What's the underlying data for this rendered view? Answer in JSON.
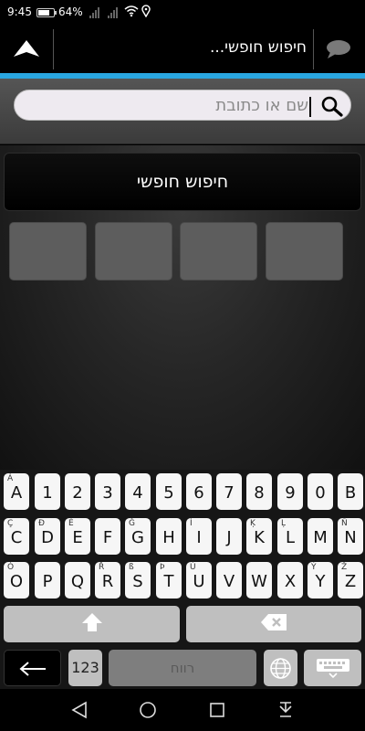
{
  "status_bar": {
    "time": "9:45",
    "battery_percent": "64%",
    "battery_level": 0.64
  },
  "header": {
    "title": "חיפוש חופשי...",
    "icons": [
      "navigation-arrow-icon",
      "chat-bubble-icon"
    ]
  },
  "search": {
    "placeholder": "שם או כתובת",
    "icons": [
      "magnifier-icon"
    ]
  },
  "content": {
    "free_search_label": "חיפוש חופשי",
    "tile_count": 4
  },
  "keyboard": {
    "row1": [
      {
        "main": "A",
        "sub": "Á"
      },
      {
        "main": "1",
        "sub": ""
      },
      {
        "main": "2",
        "sub": ""
      },
      {
        "main": "3",
        "sub": ""
      },
      {
        "main": "4",
        "sub": ""
      },
      {
        "main": "5",
        "sub": ""
      },
      {
        "main": "6",
        "sub": ""
      },
      {
        "main": "7",
        "sub": ""
      },
      {
        "main": "8",
        "sub": ""
      },
      {
        "main": "9",
        "sub": ""
      },
      {
        "main": "0",
        "sub": ""
      },
      {
        "main": "B",
        "sub": ""
      }
    ],
    "row2": [
      {
        "main": "C",
        "sub": "Ç"
      },
      {
        "main": "D",
        "sub": "Đ"
      },
      {
        "main": "E",
        "sub": "É"
      },
      {
        "main": "F",
        "sub": ""
      },
      {
        "main": "G",
        "sub": "Ğ"
      },
      {
        "main": "H",
        "sub": ""
      },
      {
        "main": "I",
        "sub": "Í"
      },
      {
        "main": "J",
        "sub": ""
      },
      {
        "main": "K",
        "sub": "Ķ"
      },
      {
        "main": "L",
        "sub": "Ļ"
      },
      {
        "main": "M",
        "sub": ""
      },
      {
        "main": "N",
        "sub": "Ñ"
      }
    ],
    "row3": [
      {
        "main": "O",
        "sub": "Ó"
      },
      {
        "main": "P",
        "sub": ""
      },
      {
        "main": "Q",
        "sub": ""
      },
      {
        "main": "R",
        "sub": "Ř"
      },
      {
        "main": "S",
        "sub": "ß"
      },
      {
        "main": "T",
        "sub": "Þ"
      },
      {
        "main": "U",
        "sub": "Ú"
      },
      {
        "main": "V",
        "sub": ""
      },
      {
        "main": "W",
        "sub": ""
      },
      {
        "main": "X",
        "sub": ""
      },
      {
        "main": "Y",
        "sub": "Ý"
      },
      {
        "main": "Z",
        "sub": "Ž"
      }
    ],
    "mode_label": "123",
    "space_label": "רווח",
    "icons": [
      "shift-arrow-icon",
      "backspace-icon",
      "back-arrow-icon",
      "globe-icon",
      "keyboard-hide-icon"
    ]
  },
  "nav_bar": {
    "icons": [
      "back-triangle-icon",
      "home-circle-icon",
      "recents-square-icon",
      "notification-pull-icon"
    ]
  }
}
